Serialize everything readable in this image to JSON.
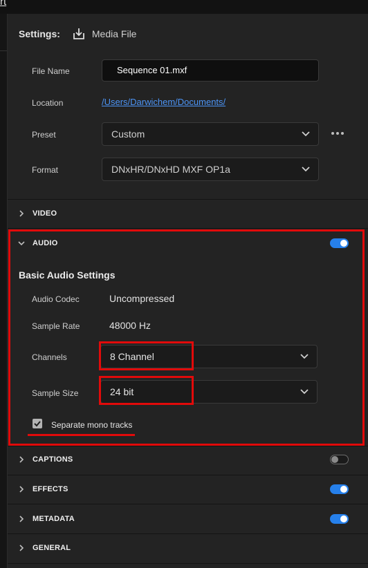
{
  "window": {
    "top_fragment": "rt"
  },
  "settings": {
    "label": "Settings:",
    "media_label": "Media File"
  },
  "fields": {
    "file_name": {
      "label": "File Name",
      "value": "Sequence 01.mxf"
    },
    "location": {
      "label": "Location",
      "value": "/Users/Darwichem/Documents/"
    },
    "preset": {
      "label": "Preset",
      "value": "Custom"
    },
    "format": {
      "label": "Format",
      "value": "DNxHR/DNxHD MXF OP1a"
    }
  },
  "sections": {
    "video": {
      "title": "VIDEO"
    },
    "audio": {
      "title": "AUDIO",
      "enabled": true
    },
    "captions": {
      "title": "CAPTIONS",
      "enabled": false
    },
    "effects": {
      "title": "EFFECTS",
      "enabled": true
    },
    "metadata": {
      "title": "METADATA",
      "enabled": true
    },
    "general": {
      "title": "GENERAL"
    }
  },
  "audio": {
    "subheading": "Basic Audio Settings",
    "codec": {
      "label": "Audio Codec",
      "value": "Uncompressed"
    },
    "sample_rate": {
      "label": "Sample Rate",
      "value": "48000 Hz"
    },
    "channels": {
      "label": "Channels",
      "value": "8 Channel"
    },
    "sample_size": {
      "label": "Sample Size",
      "value": "24 bit"
    },
    "mono": {
      "label": "Separate mono tracks",
      "checked": true
    }
  },
  "colors": {
    "accent": "#2680eb",
    "highlight": "#e20a0a",
    "link": "#4c94f5"
  }
}
